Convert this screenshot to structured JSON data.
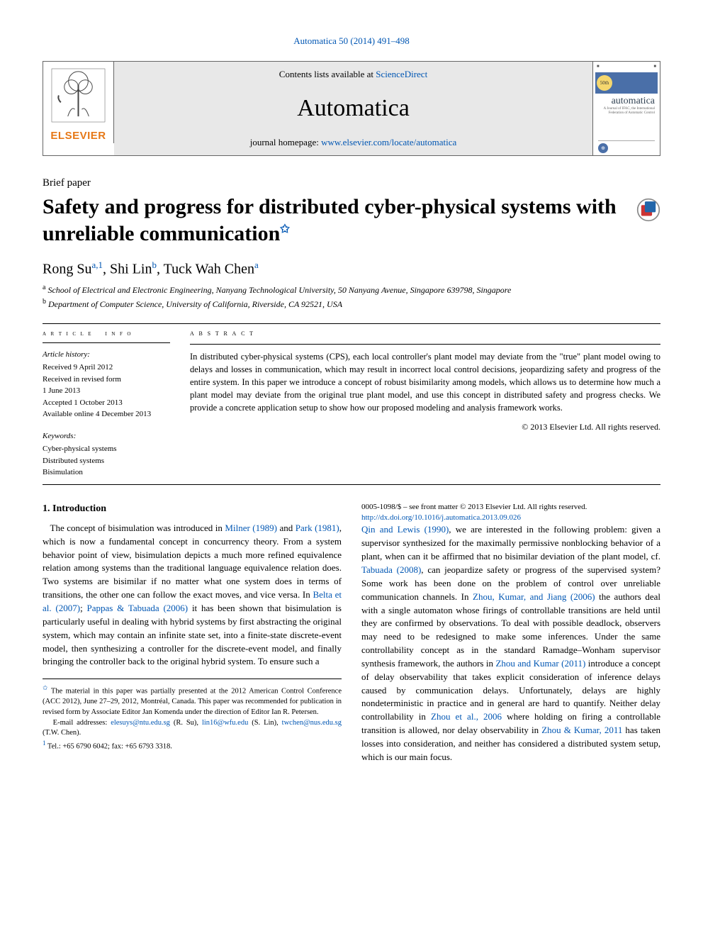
{
  "header": {
    "citation": "Automatica 50 (2014) 491–498",
    "contents_prefix": "Contents lists available at ",
    "contents_link": "ScienceDirect",
    "journal": "Automatica",
    "homepage_prefix": "journal homepage: ",
    "homepage_link": "www.elsevier.com/locate/automatica",
    "elsevier": "ELSEVIER",
    "cover_title": "automatica",
    "cover_badge": "50th"
  },
  "article": {
    "kicker": "Brief paper",
    "title_pre": "Safety and progress for distributed cyber-physical systems with unreliable communication",
    "title_sup": "✩",
    "author1": "Rong Su",
    "author1_aff": "a,1",
    "author2": "Shi Lin",
    "author2_aff": "b",
    "author3": "Tuck Wah Chen",
    "author3_aff": "a",
    "aff_a_sup": "a",
    "aff_a": " School of Electrical and Electronic Engineering, Nanyang Technological University, 50 Nanyang Avenue, Singapore 639798, Singapore",
    "aff_b_sup": "b",
    "aff_b": " Department of Computer Science, University of California, Riverside, CA 92521, USA"
  },
  "info": {
    "hist_title": "Article history:",
    "received": "Received 9 April 2012",
    "revised": "Received in revised form",
    "revised_date": "1 June 2013",
    "accepted": "Accepted 1 October 2013",
    "online": "Available online 4 December 2013",
    "kw_title": "Keywords:",
    "kw1": "Cyber-physical systems",
    "kw2": "Distributed systems",
    "kw3": "Bisimulation"
  },
  "abstract": {
    "heading": "a b s t r a c t",
    "text": "In distributed cyber-physical systems (CPS), each local controller's plant model may deviate from the \"true\" plant model owing to delays and losses in communication, which may result in incorrect local control decisions, jeopardizing safety and progress of the entire system. In this paper we introduce a concept of robust bisimilarity among models, which allows us to determine how much a plant model may deviate from the original true plant model, and use this concept in distributed safety and progress checks. We provide a concrete application setup to show how our proposed modeling and analysis framework works.",
    "copyright": "© 2013 Elsevier Ltd. All rights reserved."
  },
  "body": {
    "section_no": "1.",
    "section_title": "Introduction",
    "col1_p1a": "The concept of bisimulation was introduced in ",
    "col1_link1": "Milner (1989)",
    "col1_p1b": " and ",
    "col1_link2": "Park (1981)",
    "col1_p1c": ", which is now a fundamental concept in concurrency theory. From a system behavior point of view, bisimulation depicts a much more refined equivalence relation among systems than the traditional language equivalence relation does. Two systems are bisimilar if no matter what one system does in terms of transitions, the other one can follow the exact moves, and vice versa. In ",
    "col1_link3": "Belta et al. (2007)",
    "col1_p1d": "; ",
    "col1_link4": "Pappas & Tabuada (2006)",
    "col1_p1e": " it has been shown that bisimulation is particularly useful in dealing with hybrid systems by first abstracting the original system, which may contain an infinite state set, into a finite-state discrete-event model, then synthesizing a controller for the discrete-event model, and finally bringing the controller back to the original hybrid system. To ensure such a ",
    "col2_link1": "Qin and Lewis (1990)",
    "col2_p1a": ", we are interested in the following problem: given a supervisor synthesized for the maximally permissive nonblocking behavior of a plant, when can it be affirmed that no bisimilar deviation of the plant model, cf. ",
    "col2_link2": "Tabuada (2008)",
    "col2_p1b": ", can jeopardize safety or progress of the supervised system? Some work has been done on the problem of control over unreliable communication channels. In ",
    "col2_link3": "Zhou, Kumar, and Jiang (2006)",
    "col2_p1c": " the authors deal with a single automaton whose firings of controllable transitions are held until they are confirmed by observations. To deal with possible deadlock, observers may need to be redesigned to make some inferences. Under the same controllability concept as in the standard Ramadge–Wonham supervisor synthesis framework, the authors in ",
    "col2_link4": "Zhou and Kumar (2011)",
    "col2_p1d": " introduce a concept of delay observability that takes explicit consideration of inference delays caused by communication delays. Unfortunately, delays are highly nondeterministic in practice and in general are hard to quantify. Neither delay controllability in ",
    "col2_link5": "Zhou et al., 2006",
    "col2_p1e": " where holding on firing a controllable transition is allowed, nor delay observability in ",
    "col2_link6": "Zhou & Kumar, 2011",
    "col2_p1f": " has taken losses into consideration, and neither has considered a distributed system setup, which is our main focus."
  },
  "footnotes": {
    "f1_sup": "✩",
    "f1": " The material in this paper was partially presented at the 2012 American Control Conference (ACC 2012), June 27–29, 2012, Montréal, Canada. This paper was recommended for publication in revised form by Associate Editor Jan Komenda under the direction of Editor Ian R. Petersen.",
    "f2_prefix": "E-mail addresses: ",
    "email1": "elesuys@ntu.edu.sg",
    "f2_mid1": " (R. Su), ",
    "email2": "lin16@wfu.edu",
    "f2_mid2": " (S. Lin), ",
    "email3": "twchen@nus.edu.sg",
    "f2_end": " (T.W. Chen).",
    "f3_sup": "1",
    "f3": " Tel.: +65 6790 6042; fax: +65 6793 3318."
  },
  "doi": {
    "line1": "0005-1098/$ – see front matter © 2013 Elsevier Ltd. All rights reserved.",
    "link": "http://dx.doi.org/10.1016/j.automatica.2013.09.026"
  }
}
